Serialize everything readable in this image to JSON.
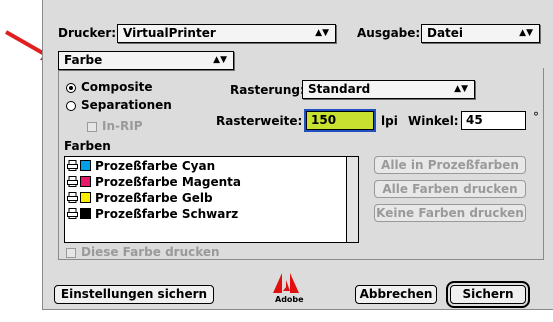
{
  "header": {
    "printer_label": "Drucker:",
    "printer_value": "VirtualPrinter",
    "output_label": "Ausgabe:",
    "output_value": "Datei"
  },
  "section_select": {
    "value": "Farbe"
  },
  "mode": {
    "composite_label": "Composite",
    "separations_label": "Separationen",
    "inrip_label": "In-RIP",
    "selected": "Composite"
  },
  "screening": {
    "label": "Rasterung:",
    "value": "Standard",
    "frequency_label": "Rasterweite:",
    "frequency_value": "150",
    "frequency_unit": "lpi",
    "angle_label": "Winkel:",
    "angle_value": "45",
    "angle_unit": "°"
  },
  "colors": {
    "label": "Farben",
    "items": [
      {
        "label": "Prozeßfarbe Cyan",
        "color": "#00a0e8"
      },
      {
        "label": "Prozeßfarbe Magenta",
        "color": "#e8186c"
      },
      {
        "label": "Prozeßfarbe Gelb",
        "color": "#f8ec00"
      },
      {
        "label": "Prozeßfarbe Schwarz",
        "color": "#000000"
      }
    ],
    "print_this_color_label": "Diese Farbe drucken"
  },
  "side_buttons": {
    "all_process": "Alle in Prozeßfarben",
    "print_all": "Alle Farben drucken",
    "print_none": "Keine Farben drucken"
  },
  "footer": {
    "save_settings": "Einstellungen sichern",
    "logo_text": "Adobe",
    "cancel": "Abbrechen",
    "save": "Sichern"
  },
  "accent": {
    "highlight": "#c8e030",
    "focus_ring": "#2050c0",
    "annotation_arrow": "#e02020"
  }
}
